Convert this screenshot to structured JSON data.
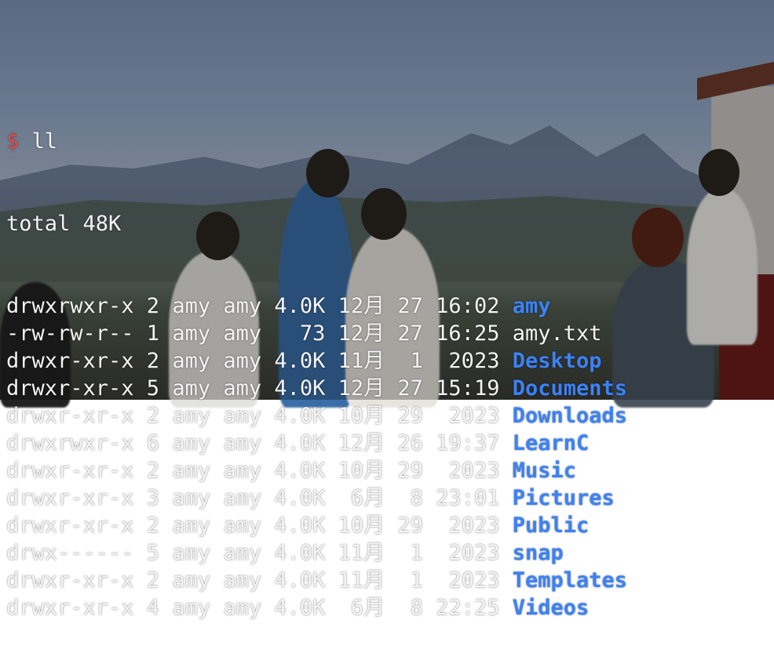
{
  "prompt": {
    "symbol": "$",
    "command": "ll"
  },
  "summary": "total 48K",
  "colors": {
    "directory": "#3b82f6",
    "prompt": "#e04b4b",
    "text": "#f4f4f4"
  },
  "entries": [
    {
      "perms": "drwxrwxr-x",
      "links": "2",
      "owner": "amy",
      "group": "amy",
      "size": "4.0K",
      "month": "12月",
      "day": "27",
      "time": "16:02",
      "name": "amy",
      "type": "dir"
    },
    {
      "perms": "-rw-rw-r--",
      "links": "1",
      "owner": "amy",
      "group": "amy",
      "size": "73",
      "month": "12月",
      "day": "27",
      "time": "16:25",
      "name": "amy.txt",
      "type": "file"
    },
    {
      "perms": "drwxr-xr-x",
      "links": "2",
      "owner": "amy",
      "group": "amy",
      "size": "4.0K",
      "month": "11月",
      "day": "1",
      "time": "2023",
      "name": "Desktop",
      "type": "dir"
    },
    {
      "perms": "drwxr-xr-x",
      "links": "5",
      "owner": "amy",
      "group": "amy",
      "size": "4.0K",
      "month": "12月",
      "day": "27",
      "time": "15:19",
      "name": "Documents",
      "type": "dir"
    },
    {
      "perms": "drwxr-xr-x",
      "links": "2",
      "owner": "amy",
      "group": "amy",
      "size": "4.0K",
      "month": "10月",
      "day": "29",
      "time": "2023",
      "name": "Downloads",
      "type": "dir"
    },
    {
      "perms": "drwxrwxr-x",
      "links": "6",
      "owner": "amy",
      "group": "amy",
      "size": "4.0K",
      "month": "12月",
      "day": "26",
      "time": "19:37",
      "name": "LearnC",
      "type": "dir"
    },
    {
      "perms": "drwxr-xr-x",
      "links": "2",
      "owner": "amy",
      "group": "amy",
      "size": "4.0K",
      "month": "10月",
      "day": "29",
      "time": "2023",
      "name": "Music",
      "type": "dir"
    },
    {
      "perms": "drwxr-xr-x",
      "links": "3",
      "owner": "amy",
      "group": "amy",
      "size": "4.0K",
      "month": "6月",
      "day": "8",
      "time": "23:01",
      "name": "Pictures",
      "type": "dir"
    },
    {
      "perms": "drwxr-xr-x",
      "links": "2",
      "owner": "amy",
      "group": "amy",
      "size": "4.0K",
      "month": "10月",
      "day": "29",
      "time": "2023",
      "name": "Public",
      "type": "dir"
    },
    {
      "perms": "drwx------",
      "links": "5",
      "owner": "amy",
      "group": "amy",
      "size": "4.0K",
      "month": "11月",
      "day": "1",
      "time": "2023",
      "name": "snap",
      "type": "dir"
    },
    {
      "perms": "drwxr-xr-x",
      "links": "2",
      "owner": "amy",
      "group": "amy",
      "size": "4.0K",
      "month": "11月",
      "day": "1",
      "time": "2023",
      "name": "Templates",
      "type": "dir"
    },
    {
      "perms": "drwxr-xr-x",
      "links": "4",
      "owner": "amy",
      "group": "amy",
      "size": "4.0K",
      "month": "6月",
      "day": "8",
      "time": "22:25",
      "name": "Videos",
      "type": "dir"
    }
  ]
}
